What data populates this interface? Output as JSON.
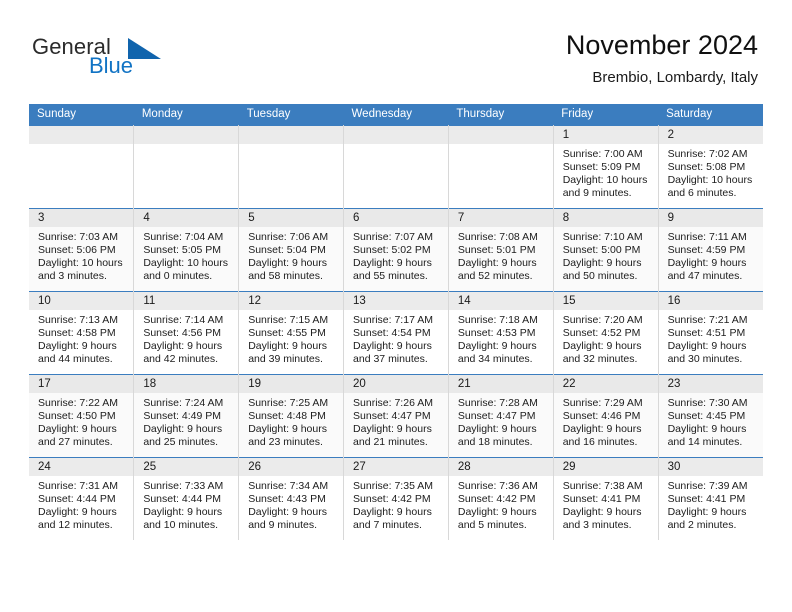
{
  "brand": {
    "word1": "General",
    "word2": "Blue",
    "logo_icon": "triangle-logo-icon",
    "accent_color": "#1173c4"
  },
  "header": {
    "title": "November 2024",
    "location": "Brembio, Lombardy, Italy"
  },
  "calendar": {
    "header_bg": "#3b7dbf",
    "weekdays": [
      "Sunday",
      "Monday",
      "Tuesday",
      "Wednesday",
      "Thursday",
      "Friday",
      "Saturday"
    ],
    "labels": {
      "sunrise": "Sunrise:",
      "sunset": "Sunset:",
      "daylight": "Daylight:"
    },
    "weeks": [
      [
        {
          "empty": true
        },
        {
          "empty": true
        },
        {
          "empty": true
        },
        {
          "empty": true
        },
        {
          "empty": true
        },
        {
          "day": "1",
          "sunrise": "Sunrise: 7:00 AM",
          "sunset": "Sunset: 5:09 PM",
          "daylight_1": "Daylight: 10 hours",
          "daylight_2": "and 9 minutes."
        },
        {
          "day": "2",
          "sunrise": "Sunrise: 7:02 AM",
          "sunset": "Sunset: 5:08 PM",
          "daylight_1": "Daylight: 10 hours",
          "daylight_2": "and 6 minutes."
        }
      ],
      [
        {
          "day": "3",
          "sunrise": "Sunrise: 7:03 AM",
          "sunset": "Sunset: 5:06 PM",
          "daylight_1": "Daylight: 10 hours",
          "daylight_2": "and 3 minutes."
        },
        {
          "day": "4",
          "sunrise": "Sunrise: 7:04 AM",
          "sunset": "Sunset: 5:05 PM",
          "daylight_1": "Daylight: 10 hours",
          "daylight_2": "and 0 minutes."
        },
        {
          "day": "5",
          "sunrise": "Sunrise: 7:06 AM",
          "sunset": "Sunset: 5:04 PM",
          "daylight_1": "Daylight: 9 hours",
          "daylight_2": "and 58 minutes."
        },
        {
          "day": "6",
          "sunrise": "Sunrise: 7:07 AM",
          "sunset": "Sunset: 5:02 PM",
          "daylight_1": "Daylight: 9 hours",
          "daylight_2": "and 55 minutes."
        },
        {
          "day": "7",
          "sunrise": "Sunrise: 7:08 AM",
          "sunset": "Sunset: 5:01 PM",
          "daylight_1": "Daylight: 9 hours",
          "daylight_2": "and 52 minutes."
        },
        {
          "day": "8",
          "sunrise": "Sunrise: 7:10 AM",
          "sunset": "Sunset: 5:00 PM",
          "daylight_1": "Daylight: 9 hours",
          "daylight_2": "and 50 minutes."
        },
        {
          "day": "9",
          "sunrise": "Sunrise: 7:11 AM",
          "sunset": "Sunset: 4:59 PM",
          "daylight_1": "Daylight: 9 hours",
          "daylight_2": "and 47 minutes."
        }
      ],
      [
        {
          "day": "10",
          "sunrise": "Sunrise: 7:13 AM",
          "sunset": "Sunset: 4:58 PM",
          "daylight_1": "Daylight: 9 hours",
          "daylight_2": "and 44 minutes."
        },
        {
          "day": "11",
          "sunrise": "Sunrise: 7:14 AM",
          "sunset": "Sunset: 4:56 PM",
          "daylight_1": "Daylight: 9 hours",
          "daylight_2": "and 42 minutes."
        },
        {
          "day": "12",
          "sunrise": "Sunrise: 7:15 AM",
          "sunset": "Sunset: 4:55 PM",
          "daylight_1": "Daylight: 9 hours",
          "daylight_2": "and 39 minutes."
        },
        {
          "day": "13",
          "sunrise": "Sunrise: 7:17 AM",
          "sunset": "Sunset: 4:54 PM",
          "daylight_1": "Daylight: 9 hours",
          "daylight_2": "and 37 minutes."
        },
        {
          "day": "14",
          "sunrise": "Sunrise: 7:18 AM",
          "sunset": "Sunset: 4:53 PM",
          "daylight_1": "Daylight: 9 hours",
          "daylight_2": "and 34 minutes."
        },
        {
          "day": "15",
          "sunrise": "Sunrise: 7:20 AM",
          "sunset": "Sunset: 4:52 PM",
          "daylight_1": "Daylight: 9 hours",
          "daylight_2": "and 32 minutes."
        },
        {
          "day": "16",
          "sunrise": "Sunrise: 7:21 AM",
          "sunset": "Sunset: 4:51 PM",
          "daylight_1": "Daylight: 9 hours",
          "daylight_2": "and 30 minutes."
        }
      ],
      [
        {
          "day": "17",
          "sunrise": "Sunrise: 7:22 AM",
          "sunset": "Sunset: 4:50 PM",
          "daylight_1": "Daylight: 9 hours",
          "daylight_2": "and 27 minutes."
        },
        {
          "day": "18",
          "sunrise": "Sunrise: 7:24 AM",
          "sunset": "Sunset: 4:49 PM",
          "daylight_1": "Daylight: 9 hours",
          "daylight_2": "and 25 minutes."
        },
        {
          "day": "19",
          "sunrise": "Sunrise: 7:25 AM",
          "sunset": "Sunset: 4:48 PM",
          "daylight_1": "Daylight: 9 hours",
          "daylight_2": "and 23 minutes."
        },
        {
          "day": "20",
          "sunrise": "Sunrise: 7:26 AM",
          "sunset": "Sunset: 4:47 PM",
          "daylight_1": "Daylight: 9 hours",
          "daylight_2": "and 21 minutes."
        },
        {
          "day": "21",
          "sunrise": "Sunrise: 7:28 AM",
          "sunset": "Sunset: 4:47 PM",
          "daylight_1": "Daylight: 9 hours",
          "daylight_2": "and 18 minutes."
        },
        {
          "day": "22",
          "sunrise": "Sunrise: 7:29 AM",
          "sunset": "Sunset: 4:46 PM",
          "daylight_1": "Daylight: 9 hours",
          "daylight_2": "and 16 minutes."
        },
        {
          "day": "23",
          "sunrise": "Sunrise: 7:30 AM",
          "sunset": "Sunset: 4:45 PM",
          "daylight_1": "Daylight: 9 hours",
          "daylight_2": "and 14 minutes."
        }
      ],
      [
        {
          "day": "24",
          "sunrise": "Sunrise: 7:31 AM",
          "sunset": "Sunset: 4:44 PM",
          "daylight_1": "Daylight: 9 hours",
          "daylight_2": "and 12 minutes."
        },
        {
          "day": "25",
          "sunrise": "Sunrise: 7:33 AM",
          "sunset": "Sunset: 4:44 PM",
          "daylight_1": "Daylight: 9 hours",
          "daylight_2": "and 10 minutes."
        },
        {
          "day": "26",
          "sunrise": "Sunrise: 7:34 AM",
          "sunset": "Sunset: 4:43 PM",
          "daylight_1": "Daylight: 9 hours",
          "daylight_2": "and 9 minutes."
        },
        {
          "day": "27",
          "sunrise": "Sunrise: 7:35 AM",
          "sunset": "Sunset: 4:42 PM",
          "daylight_1": "Daylight: 9 hours",
          "daylight_2": "and 7 minutes."
        },
        {
          "day": "28",
          "sunrise": "Sunrise: 7:36 AM",
          "sunset": "Sunset: 4:42 PM",
          "daylight_1": "Daylight: 9 hours",
          "daylight_2": "and 5 minutes."
        },
        {
          "day": "29",
          "sunrise": "Sunrise: 7:38 AM",
          "sunset": "Sunset: 4:41 PM",
          "daylight_1": "Daylight: 9 hours",
          "daylight_2": "and 3 minutes."
        },
        {
          "day": "30",
          "sunrise": "Sunrise: 7:39 AM",
          "sunset": "Sunset: 4:41 PM",
          "daylight_1": "Daylight: 9 hours",
          "daylight_2": "and 2 minutes."
        }
      ]
    ]
  }
}
